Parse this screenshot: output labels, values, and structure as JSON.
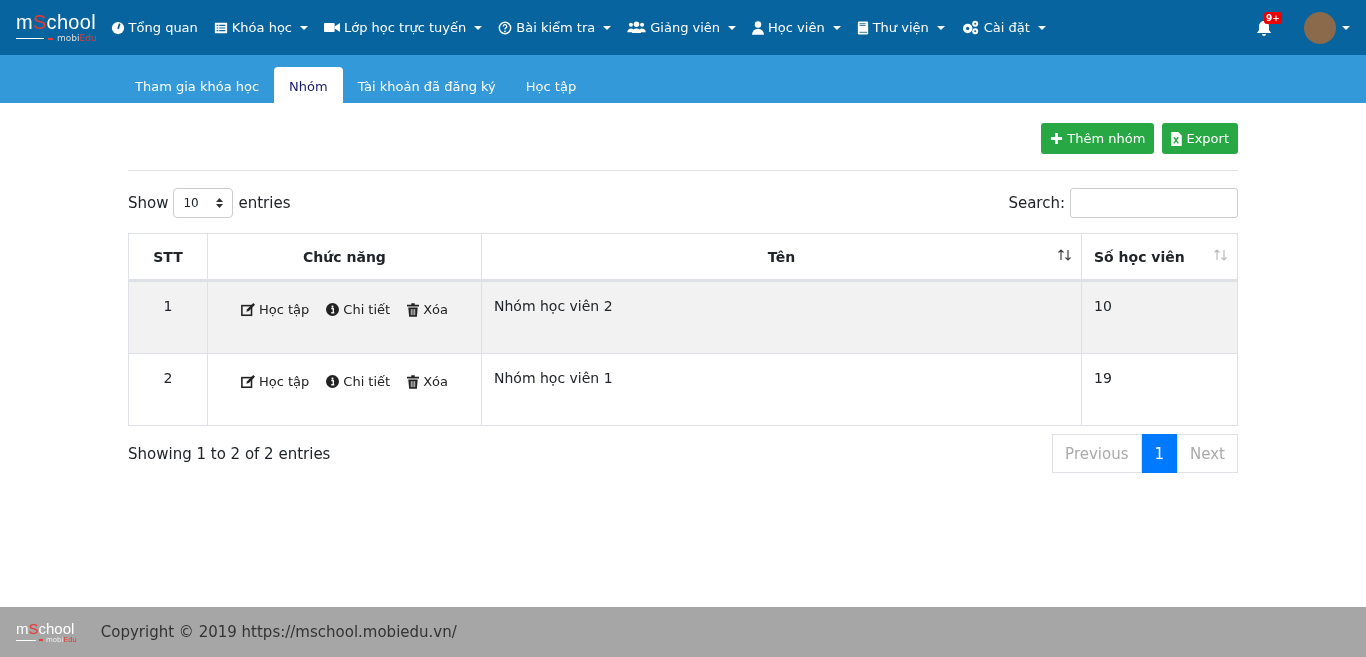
{
  "navbar": {
    "logo": {
      "prefix": "m",
      "highlight": "S",
      "suffix": "chool",
      "sub_prefix": "mobi",
      "sub_highlight": "Edu"
    },
    "items": [
      {
        "label": "Tổng quan",
        "dropdown": false
      },
      {
        "label": "Khóa học",
        "dropdown": true
      },
      {
        "label": "Lớp học trực tuyến",
        "dropdown": true
      },
      {
        "label": "Bài kiểm tra",
        "dropdown": true
      },
      {
        "label": "Giảng viên",
        "dropdown": true
      },
      {
        "label": "Học viên",
        "dropdown": true
      },
      {
        "label": "Thư viện",
        "dropdown": true
      },
      {
        "label": "Cài đặt",
        "dropdown": true
      }
    ],
    "notifications": {
      "badge": "9+"
    }
  },
  "tabs": [
    {
      "label": "Tham gia khóa học",
      "selected": false
    },
    {
      "label": "Nhóm",
      "selected": true
    },
    {
      "label": "Tài khoản đã đăng ký",
      "selected": false
    },
    {
      "label": "Học tập",
      "selected": false
    }
  ],
  "toolbar": {
    "buttons": [
      {
        "label": "Thêm nhóm"
      },
      {
        "label": "Export"
      }
    ]
  },
  "table_controls": {
    "show_label": "Show",
    "page_size": "10",
    "entries_label": "entries",
    "search_label": "Search:"
  },
  "table": {
    "columns": [
      {
        "label": "STT"
      },
      {
        "label": "Chức năng"
      },
      {
        "label": "Tên",
        "sorted": true
      },
      {
        "label": "Số học viên",
        "sorted": false
      }
    ],
    "rows": [
      {
        "stt": "1",
        "actions": [
          "Học tập",
          "Chi tiết",
          "Xóa"
        ],
        "name": "Nhóm học viên 2",
        "count": "10"
      },
      {
        "stt": "2",
        "actions": [
          "Học tập",
          "Chi tiết",
          "Xóa"
        ],
        "name": "Nhóm học viên 1",
        "count": "19"
      }
    ]
  },
  "table_info": "Showing 1 to 2 of 2 entries",
  "pagination": {
    "previous": {
      "label": "Previous",
      "disabled": true
    },
    "pages": [
      {
        "label": "1",
        "selected": true
      }
    ],
    "next": {
      "label": "Next",
      "disabled": true
    }
  },
  "footer": {
    "logo": {
      "prefix": "m",
      "highlight": "S",
      "suffix": "chool",
      "sub_prefix": "mobi",
      "sub_highlight": "Edu"
    },
    "copyright": "Copyright © 2019 https://mschool.mobiedu.vn/"
  }
}
